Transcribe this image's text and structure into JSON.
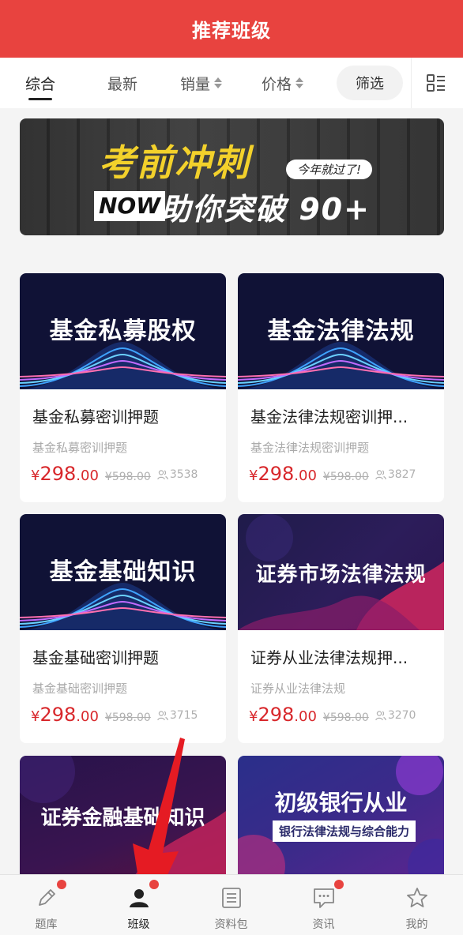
{
  "header": {
    "title": "推荐班级"
  },
  "sort_tabs": [
    {
      "label": "综合",
      "active": true
    },
    {
      "label": "最新"
    },
    {
      "label": "销量"
    },
    {
      "label": "价格"
    }
  ],
  "filter_label": "筛选",
  "banner": {
    "line1": "考前冲刺",
    "pill": "今年就过了!",
    "now": "NOW",
    "line2": "助你突破 90+"
  },
  "courses": [
    {
      "cover_title": "基金私募股权",
      "name": "基金私募密训押题",
      "subtitle": "基金私募密训押题",
      "currency": "¥",
      "price_int": "298",
      "price_dec": ".00",
      "original_price": "¥598.00",
      "buyers": "3538"
    },
    {
      "cover_title": "基金法律法规",
      "name": "基金法律法规密训押...",
      "subtitle": "基金法律法规密训押题",
      "currency": "¥",
      "price_int": "298",
      "price_dec": ".00",
      "original_price": "¥598.00",
      "buyers": "3827"
    },
    {
      "cover_title": "基金基础知识",
      "name": "基金基础密训押题",
      "subtitle": "基金基础密训押题",
      "currency": "¥",
      "price_int": "298",
      "price_dec": ".00",
      "original_price": "¥598.00",
      "buyers": "3715"
    },
    {
      "cover_title": "证券市场法律法规",
      "name": "证券从业法律法规押...",
      "subtitle": "证券从业法律法规",
      "currency": "¥",
      "price_int": "298",
      "price_dec": ".00",
      "original_price": "¥598.00",
      "buyers": "3270"
    }
  ],
  "partial_courses": [
    {
      "cover_title": "证券金融基础知识"
    },
    {
      "cover_title": "初级银行从业",
      "cover_subtitle": "银行法律法规与综合能力"
    }
  ],
  "bottom_nav": [
    {
      "label": "题库",
      "icon": "pencil-icon",
      "badge": true
    },
    {
      "label": "班级",
      "icon": "person-icon",
      "badge": true,
      "active": true
    },
    {
      "label": "资料包",
      "icon": "document-icon",
      "badge": false
    },
    {
      "label": "资讯",
      "icon": "message-icon",
      "badge": true
    },
    {
      "label": "我的",
      "icon": "star-icon",
      "badge": false
    }
  ],
  "colors": {
    "brand": "#e8433f",
    "price": "#d8272b"
  }
}
